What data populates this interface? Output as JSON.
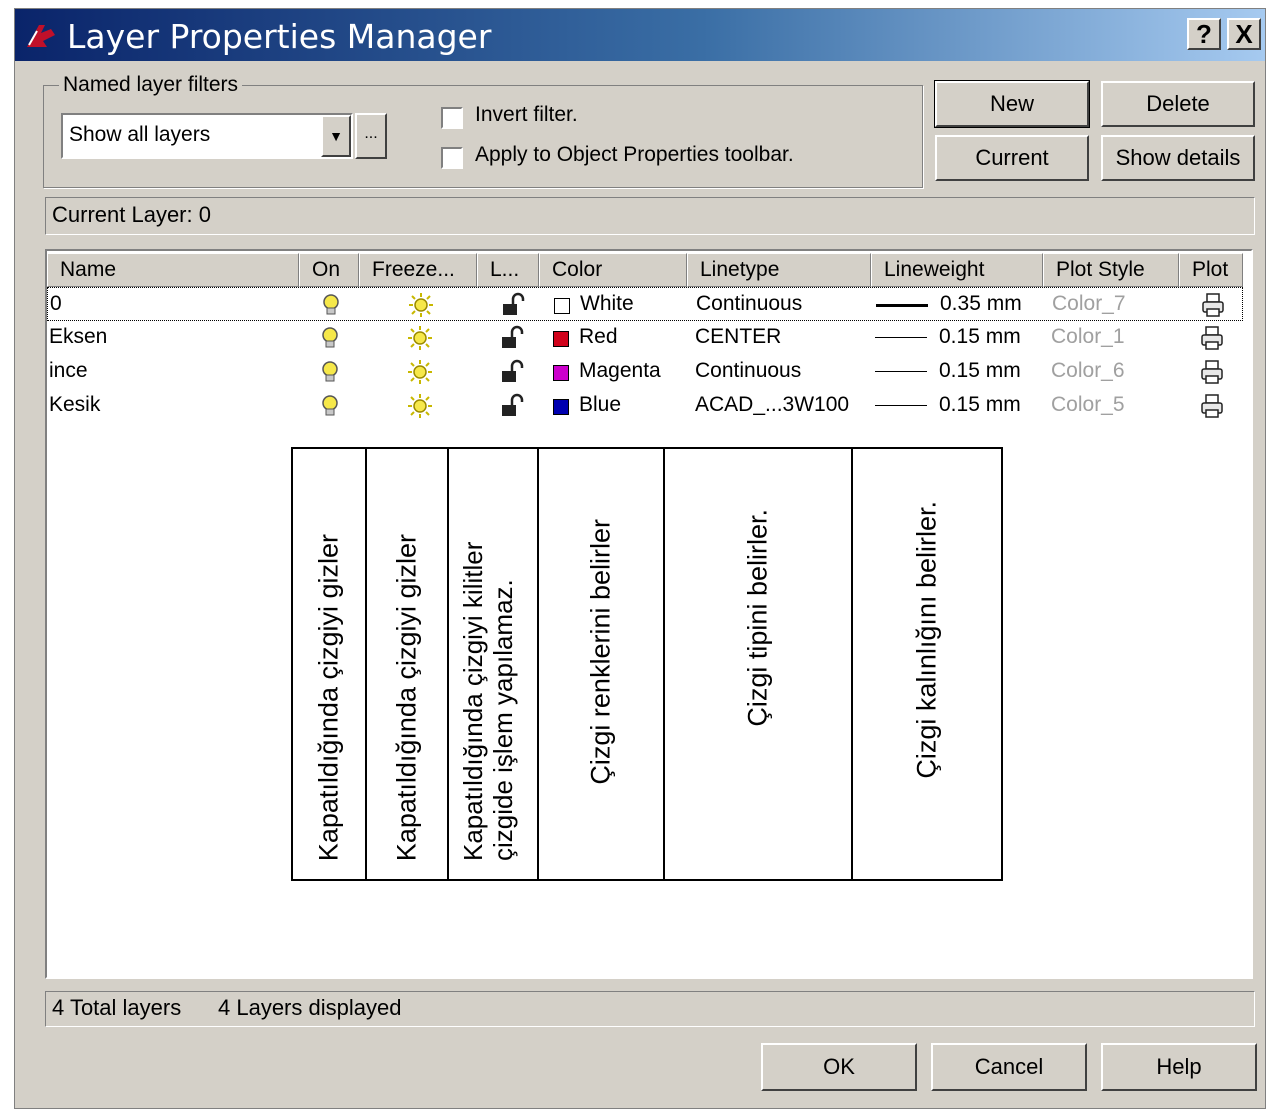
{
  "window": {
    "title": "Layer Properties Manager",
    "help_button": "?",
    "close_button": "X"
  },
  "filters": {
    "group_label": "Named layer filters",
    "selected": "Show all layers",
    "browse_label": "...",
    "invert_filter_label": "Invert filter.",
    "apply_toolbar_label": "Apply to Object Properties toolbar."
  },
  "buttons": {
    "new": "New",
    "delete": "Delete",
    "current": "Current",
    "show_details": "Show details",
    "ok": "OK",
    "cancel": "Cancel",
    "help": "Help"
  },
  "current_layer": "Current Layer:  0",
  "columns": [
    "Name",
    "On",
    "Freeze...",
    "L...",
    "Color",
    "Linetype",
    "Lineweight",
    "Plot Style",
    "Plot"
  ],
  "layers": [
    {
      "name": "0",
      "color_name": "White",
      "color_hex": "#ffffff",
      "linetype": "Continuous",
      "lineweight": "0.35 mm",
      "plot_style": "Color_7"
    },
    {
      "name": "Eksen",
      "color_name": "Red",
      "color_hex": "#d0021b",
      "linetype": "CENTER",
      "lineweight": "0.15 mm",
      "plot_style": "Color_1"
    },
    {
      "name": "ince",
      "color_name": "Magenta",
      "color_hex": "#cc00cc",
      "linetype": "Continuous",
      "lineweight": "0.15 mm",
      "plot_style": "Color_6"
    },
    {
      "name": "Kesik",
      "color_name": "Blue",
      "color_hex": "#0000b0",
      "linetype": "ACAD_...3W100",
      "lineweight": "0.15 mm",
      "plot_style": "Color_5"
    }
  ],
  "icons": {
    "on": "lightbulb-icon",
    "freeze": "sun-icon",
    "lock": "unlocked-padlock-icon",
    "plot": "printer-icon"
  },
  "annotations": [
    {
      "text": "Kapatıldığında çizgiyi gizler"
    },
    {
      "text": "Kapatıldığında çizgiyi gizler"
    },
    {
      "text": "Kapatıldığında çizgiyi kilitler çizgide işlem yapılamaz."
    },
    {
      "text": "Çizgi renklerini belirler"
    },
    {
      "text": "Çizgi tipini belirler."
    },
    {
      "text": "Çizgi kalınlığını belirler."
    }
  ],
  "status": {
    "total": "4 Total layers",
    "displayed": "4 Layers displayed"
  }
}
